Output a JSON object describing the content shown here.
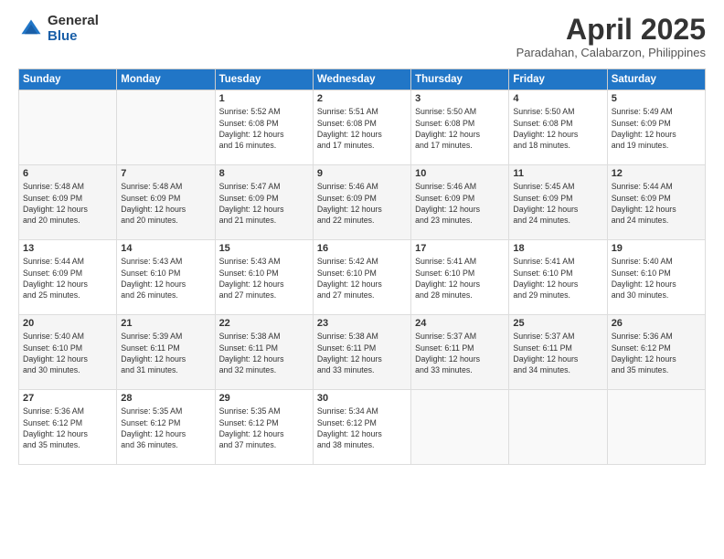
{
  "logo": {
    "general": "General",
    "blue": "Blue"
  },
  "header": {
    "month": "April 2025",
    "location": "Paradahan, Calabarzon, Philippines"
  },
  "days_of_week": [
    "Sunday",
    "Monday",
    "Tuesday",
    "Wednesday",
    "Thursday",
    "Friday",
    "Saturday"
  ],
  "weeks": [
    [
      {
        "day": "",
        "info": ""
      },
      {
        "day": "",
        "info": ""
      },
      {
        "day": "1",
        "sunrise": "5:52 AM",
        "sunset": "6:08 PM",
        "daylight": "12 hours and 16 minutes."
      },
      {
        "day": "2",
        "sunrise": "5:51 AM",
        "sunset": "6:08 PM",
        "daylight": "12 hours and 17 minutes."
      },
      {
        "day": "3",
        "sunrise": "5:50 AM",
        "sunset": "6:08 PM",
        "daylight": "12 hours and 17 minutes."
      },
      {
        "day": "4",
        "sunrise": "5:50 AM",
        "sunset": "6:08 PM",
        "daylight": "12 hours and 18 minutes."
      },
      {
        "day": "5",
        "sunrise": "5:49 AM",
        "sunset": "6:09 PM",
        "daylight": "12 hours and 19 minutes."
      }
    ],
    [
      {
        "day": "6",
        "sunrise": "5:48 AM",
        "sunset": "6:09 PM",
        "daylight": "12 hours and 20 minutes."
      },
      {
        "day": "7",
        "sunrise": "5:48 AM",
        "sunset": "6:09 PM",
        "daylight": "12 hours and 20 minutes."
      },
      {
        "day": "8",
        "sunrise": "5:47 AM",
        "sunset": "6:09 PM",
        "daylight": "12 hours and 21 minutes."
      },
      {
        "day": "9",
        "sunrise": "5:46 AM",
        "sunset": "6:09 PM",
        "daylight": "12 hours and 22 minutes."
      },
      {
        "day": "10",
        "sunrise": "5:46 AM",
        "sunset": "6:09 PM",
        "daylight": "12 hours and 23 minutes."
      },
      {
        "day": "11",
        "sunrise": "5:45 AM",
        "sunset": "6:09 PM",
        "daylight": "12 hours and 24 minutes."
      },
      {
        "day": "12",
        "sunrise": "5:44 AM",
        "sunset": "6:09 PM",
        "daylight": "12 hours and 24 minutes."
      }
    ],
    [
      {
        "day": "13",
        "sunrise": "5:44 AM",
        "sunset": "6:09 PM",
        "daylight": "12 hours and 25 minutes."
      },
      {
        "day": "14",
        "sunrise": "5:43 AM",
        "sunset": "6:10 PM",
        "daylight": "12 hours and 26 minutes."
      },
      {
        "day": "15",
        "sunrise": "5:43 AM",
        "sunset": "6:10 PM",
        "daylight": "12 hours and 27 minutes."
      },
      {
        "day": "16",
        "sunrise": "5:42 AM",
        "sunset": "6:10 PM",
        "daylight": "12 hours and 27 minutes."
      },
      {
        "day": "17",
        "sunrise": "5:41 AM",
        "sunset": "6:10 PM",
        "daylight": "12 hours and 28 minutes."
      },
      {
        "day": "18",
        "sunrise": "5:41 AM",
        "sunset": "6:10 PM",
        "daylight": "12 hours and 29 minutes."
      },
      {
        "day": "19",
        "sunrise": "5:40 AM",
        "sunset": "6:10 PM",
        "daylight": "12 hours and 30 minutes."
      }
    ],
    [
      {
        "day": "20",
        "sunrise": "5:40 AM",
        "sunset": "6:10 PM",
        "daylight": "12 hours and 30 minutes."
      },
      {
        "day": "21",
        "sunrise": "5:39 AM",
        "sunset": "6:11 PM",
        "daylight": "12 hours and 31 minutes."
      },
      {
        "day": "22",
        "sunrise": "5:38 AM",
        "sunset": "6:11 PM",
        "daylight": "12 hours and 32 minutes."
      },
      {
        "day": "23",
        "sunrise": "5:38 AM",
        "sunset": "6:11 PM",
        "daylight": "12 hours and 33 minutes."
      },
      {
        "day": "24",
        "sunrise": "5:37 AM",
        "sunset": "6:11 PM",
        "daylight": "12 hours and 33 minutes."
      },
      {
        "day": "25",
        "sunrise": "5:37 AM",
        "sunset": "6:11 PM",
        "daylight": "12 hours and 34 minutes."
      },
      {
        "day": "26",
        "sunrise": "5:36 AM",
        "sunset": "6:12 PM",
        "daylight": "12 hours and 35 minutes."
      }
    ],
    [
      {
        "day": "27",
        "sunrise": "5:36 AM",
        "sunset": "6:12 PM",
        "daylight": "12 hours and 35 minutes."
      },
      {
        "day": "28",
        "sunrise": "5:35 AM",
        "sunset": "6:12 PM",
        "daylight": "12 hours and 36 minutes."
      },
      {
        "day": "29",
        "sunrise": "5:35 AM",
        "sunset": "6:12 PM",
        "daylight": "12 hours and 37 minutes."
      },
      {
        "day": "30",
        "sunrise": "5:34 AM",
        "sunset": "6:12 PM",
        "daylight": "12 hours and 38 minutes."
      },
      {
        "day": "",
        "info": ""
      },
      {
        "day": "",
        "info": ""
      },
      {
        "day": "",
        "info": ""
      }
    ]
  ]
}
